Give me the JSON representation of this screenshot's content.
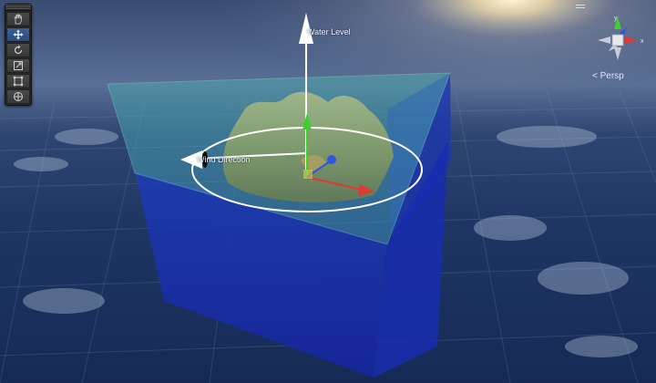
{
  "scene_view": {
    "water_level_label": "Water Level",
    "wind_direction_label": "Wind Direction"
  },
  "toolbar": {
    "tools": [
      {
        "name": "hand-tool",
        "icon": "hand-icon",
        "active": false
      },
      {
        "name": "move-tool",
        "icon": "move-arrows-icon",
        "active": true
      },
      {
        "name": "rotate-tool",
        "icon": "rotate-icon",
        "active": false
      },
      {
        "name": "scale-tool",
        "icon": "scale-icon",
        "active": false
      },
      {
        "name": "rect-tool",
        "icon": "rect-transform-icon",
        "active": false
      },
      {
        "name": "transform-tool",
        "icon": "transform-icon",
        "active": false
      }
    ]
  },
  "gizmo": {
    "axis_y": "y",
    "axis_x": "x",
    "projection_label": "< Persp"
  },
  "colors": {
    "sky_top": "#2a3e66",
    "water_surface": "#3a82b0",
    "water_body": "#1a2fa8",
    "axis_x": "#e03a30",
    "axis_y": "#3ad12a",
    "axis_z": "#2f56e0",
    "handle": "#ffffff"
  }
}
